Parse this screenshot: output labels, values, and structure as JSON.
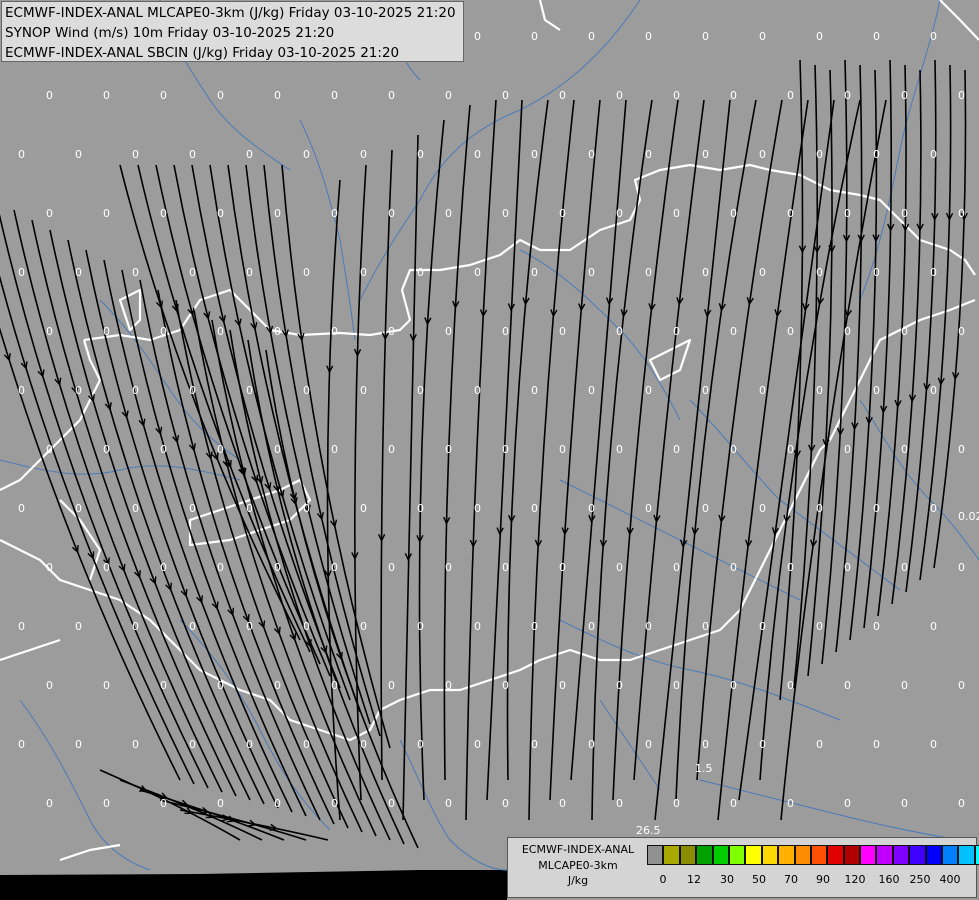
{
  "titles": [
    "ECMWF-INDEX-ANAL MLCAPE0-3km (J/kg) Friday 03-10-2025 21:20",
    "SYNOP Wind (m/s) 10m Friday 03-10-2025 21:20",
    "ECMWF-INDEX-ANAL SBCIN (J/kg) Friday 03-10-2025 21:20"
  ],
  "legend": {
    "line1": "ECMWF-INDEX-ANAL",
    "line2": "MLCAPE0-3km",
    "unit": "J/kg",
    "colors": [
      "#909090",
      "#a8a800",
      "#8c8c00",
      "#00a000",
      "#00cc00",
      "#80ff00",
      "#ffff00",
      "#ffd700",
      "#ffb000",
      "#ff8c00",
      "#ff5000",
      "#e00000",
      "#b00000",
      "#ff00ff",
      "#c000ff",
      "#8000ff",
      "#4000ff",
      "#0000ff",
      "#0080ff",
      "#00c0ff",
      "#00ffff",
      "#80ffff",
      "#ffffff"
    ],
    "ticks": [
      "0",
      "12",
      "30",
      "50",
      "70",
      "90",
      "120",
      "160",
      "250",
      "400"
    ]
  },
  "map_values": {
    "zero_label": "0",
    "special": [
      {
        "label": "1.5",
        "col": "c12",
        "row": "r13"
      },
      {
        "label": "26.5",
        "col": "c11",
        "row": "r14"
      },
      {
        "label": "0.02",
        "col": "c16",
        "row": "r9"
      }
    ]
  },
  "colors": {
    "background": "#9c9c9c",
    "border": "#ffffff",
    "river": "#4a7bb8",
    "streamline": "#000000",
    "label": "#ffffff",
    "outside": "#000000"
  }
}
